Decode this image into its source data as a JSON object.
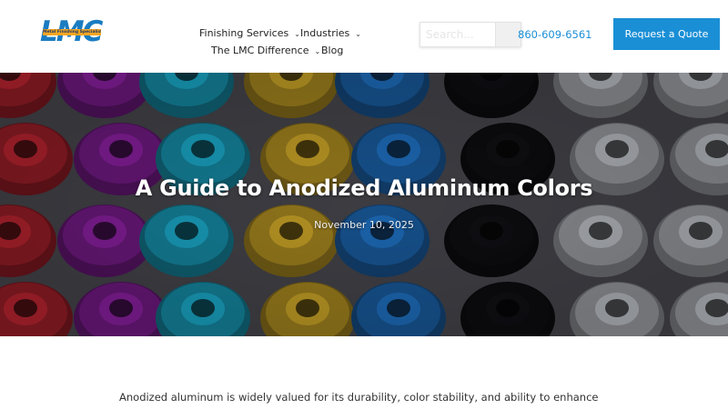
{
  "header": {
    "logo": {
      "letters": "LMC",
      "tagline": "Metal Finishing Specialists"
    },
    "nav": [
      {
        "label": "Finishing Services",
        "has_dropdown": true
      },
      {
        "label": "Industries",
        "has_dropdown": true
      },
      {
        "label": "The LMC Difference",
        "has_dropdown": true
      },
      {
        "label": "Blog",
        "has_dropdown": false
      }
    ],
    "search": {
      "placeholder": "Search..."
    },
    "phone": "860-609-6561",
    "cta": "Request a Quote"
  },
  "hero": {
    "title": "A Guide to Anodized Aluminum Colors",
    "date": "November 10, 2025",
    "part_colors": [
      "#b8232f",
      "#8a1fa0",
      "#1aa9c9",
      "#c9a326",
      "#1e6fc0",
      "#101014",
      "#b9bcc2"
    ]
  },
  "article": {
    "intro": "Anodized aluminum is widely valued for its durability, color stability, and ability to enhance both"
  },
  "colors": {
    "accent": "#1a8fd6",
    "logo": "#1a7cc1",
    "logo_tag": "#f5a623"
  }
}
